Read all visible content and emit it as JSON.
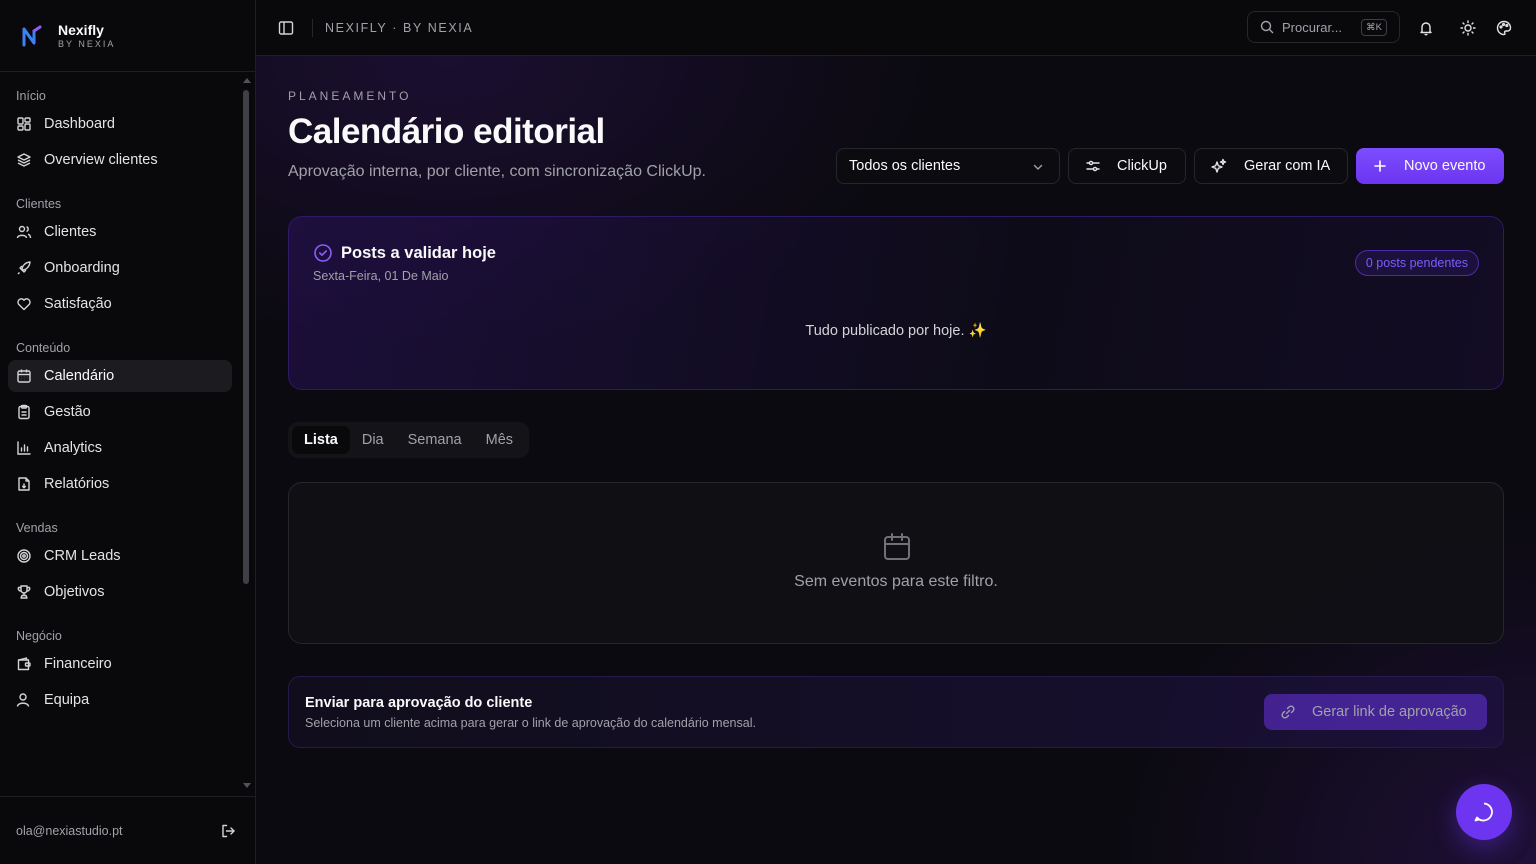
{
  "brand": {
    "name": "Nexifly",
    "sub": "BY NEXIA"
  },
  "sidebar": {
    "groups": [
      {
        "label": "Início",
        "items": [
          {
            "label": "Dashboard",
            "icon": "grid-icon"
          },
          {
            "label": "Overview clientes",
            "icon": "layers-icon"
          }
        ]
      },
      {
        "label": "Clientes",
        "items": [
          {
            "label": "Clientes",
            "icon": "users-icon"
          },
          {
            "label": "Onboarding",
            "icon": "rocket-icon"
          },
          {
            "label": "Satisfação",
            "icon": "heart-icon"
          }
        ]
      },
      {
        "label": "Conteúdo",
        "items": [
          {
            "label": "Calendário",
            "icon": "calendar-icon",
            "active": true
          },
          {
            "label": "Gestão",
            "icon": "clipboard-icon"
          },
          {
            "label": "Analytics",
            "icon": "bar-chart-icon"
          },
          {
            "label": "Relatórios",
            "icon": "file-down-icon"
          }
        ]
      },
      {
        "label": "Vendas",
        "items": [
          {
            "label": "CRM Leads",
            "icon": "target-icon"
          },
          {
            "label": "Objetivos",
            "icon": "trophy-icon"
          }
        ]
      },
      {
        "label": "Negócio",
        "items": [
          {
            "label": "Financeiro",
            "icon": "wallet-icon"
          },
          {
            "label": "Equipa",
            "icon": "user-icon"
          }
        ]
      }
    ],
    "user_email": "ola@nexiastudio.pt"
  },
  "topbar": {
    "breadcrumb": "NEXIFLY · BY NEXIA",
    "search_placeholder": "Procurar...",
    "search_shortcut": "⌘K"
  },
  "page": {
    "eyebrow": "PLANEAMENTO",
    "title": "Calendário editorial",
    "subtitle": "Aprovação interna, por cliente, com sincronização ClickUp."
  },
  "toolbar": {
    "client_select": "Todos os clientes",
    "clickup_label": "ClickUp",
    "ai_label": "Gerar com IA",
    "new_event_label": "Novo evento"
  },
  "posts_card": {
    "title": "Posts a validar hoje",
    "date": "Sexta-Feira, 01 De Maio",
    "badge": "0 posts pendentes",
    "empty": "Tudo publicado por hoje. ✨"
  },
  "tabs": [
    {
      "label": "Lista",
      "active": true
    },
    {
      "label": "Dia"
    },
    {
      "label": "Semana"
    },
    {
      "label": "Mês"
    }
  ],
  "events": {
    "empty": "Sem eventos para este filtro."
  },
  "approval": {
    "title": "Enviar para aprovação do cliente",
    "desc": "Seleciona um cliente acima para gerar o link de aprovação do calendário mensal.",
    "button": "Gerar link de aprovação"
  },
  "colors": {
    "accent": "#7c4dff",
    "background": "#09090b"
  }
}
